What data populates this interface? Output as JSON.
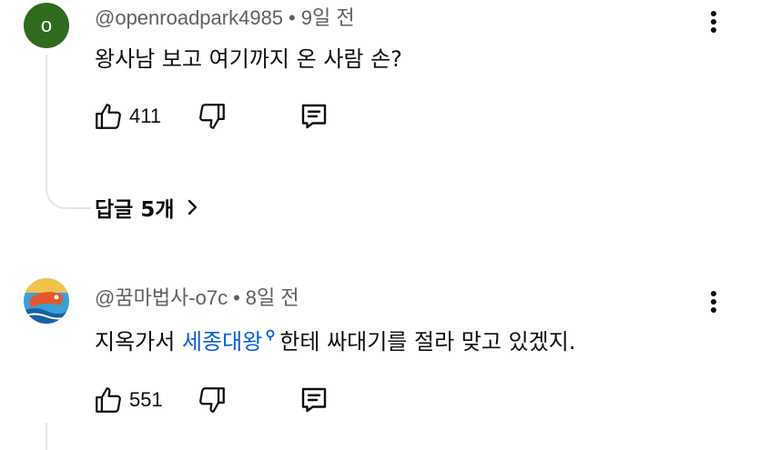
{
  "comments": [
    {
      "avatar_letter": "o",
      "author": "@openroadpark4985",
      "separator": "•",
      "time": "9일 전",
      "text": "왕사남 보고 여기까지 온 사람 손?",
      "likes": "411",
      "replies_label": "답글 5개"
    },
    {
      "author": "@꿈마법사-o7c",
      "separator": "•",
      "time": "8일 전",
      "text_before": "지옥가서 ",
      "link_text": "세종대왕",
      "text_after": "한테 싸대기를 절라 맞고 있겠지.",
      "likes": "551"
    }
  ],
  "colors": {
    "link": "#065fd4",
    "meta": "#606060",
    "avatar_green": "#2e6b1f"
  },
  "icons": [
    "thumb-up-icon",
    "thumb-down-icon",
    "reply-icon",
    "more-vert-icon",
    "chevron-right-icon",
    "search-icon"
  ]
}
